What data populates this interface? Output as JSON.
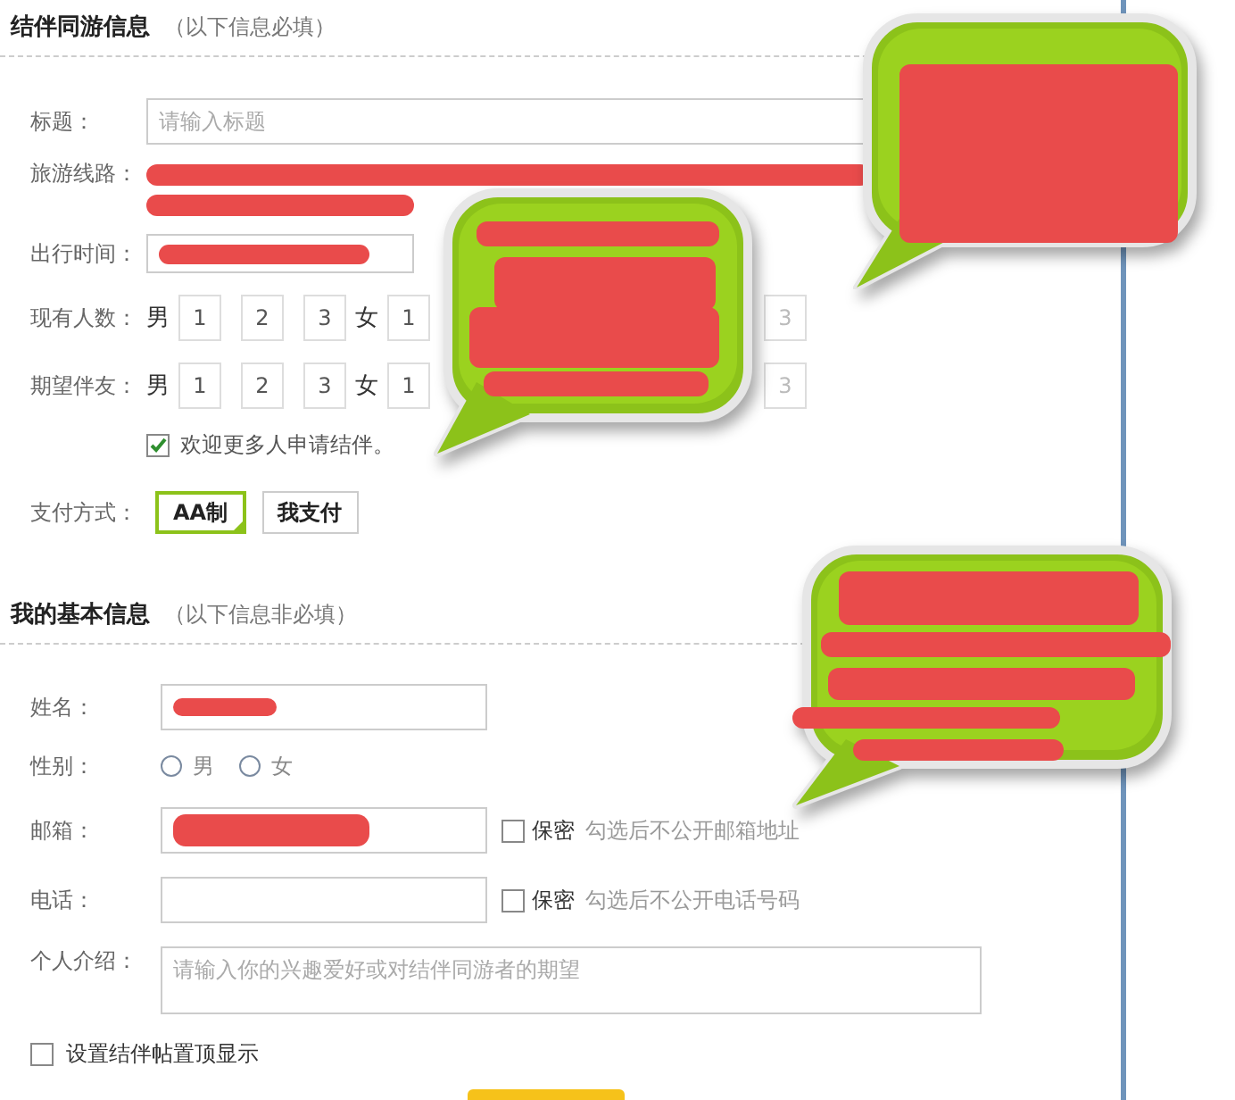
{
  "trip": {
    "title": "结伴同游信息",
    "note": "（以下信息必填）",
    "title_field": {
      "label": "标题：",
      "placeholder": "请输入标题"
    },
    "route": {
      "label": "旅游线路："
    },
    "time": {
      "label": "出行时间："
    },
    "current_people": {
      "label": "现有人数：",
      "male_label": "男",
      "male_options": [
        "1",
        "2",
        "3"
      ],
      "female_label": "女",
      "female_options": [
        "1",
        "3"
      ]
    },
    "expected_partners": {
      "label": "期望伴友：",
      "male_label": "男",
      "male_options": [
        "1",
        "2",
        "3"
      ],
      "female_label": "女",
      "female_options": [
        "1",
        "3"
      ]
    },
    "welcome_checkbox": {
      "label": "欢迎更多人申请结伴。",
      "checked": true
    },
    "payment": {
      "label": "支付方式：",
      "options": [
        {
          "label": "AA制",
          "selected": true
        },
        {
          "label": "我支付",
          "selected": false
        }
      ]
    }
  },
  "basic": {
    "title": "我的基本信息",
    "note": "（以下信息非必填）",
    "name": {
      "label": "姓名："
    },
    "gender": {
      "label": "性别：",
      "options": [
        {
          "label": "男",
          "selected": false
        },
        {
          "label": "女",
          "selected": false
        }
      ]
    },
    "email": {
      "label": "邮箱：",
      "private": {
        "label": "保密",
        "checked": false
      },
      "hint": "勾选后不公开邮箱地址"
    },
    "phone": {
      "label": "电话：",
      "private": {
        "label": "保密",
        "checked": false
      },
      "hint": "勾选后不公开电话号码"
    },
    "intro": {
      "label": "个人介绍：",
      "placeholder": "请输入你的兴趣爱好或对结伴同游者的期望"
    }
  },
  "pin_checkbox": {
    "label": "设置结伴帖置顶显示",
    "checked": false
  }
}
